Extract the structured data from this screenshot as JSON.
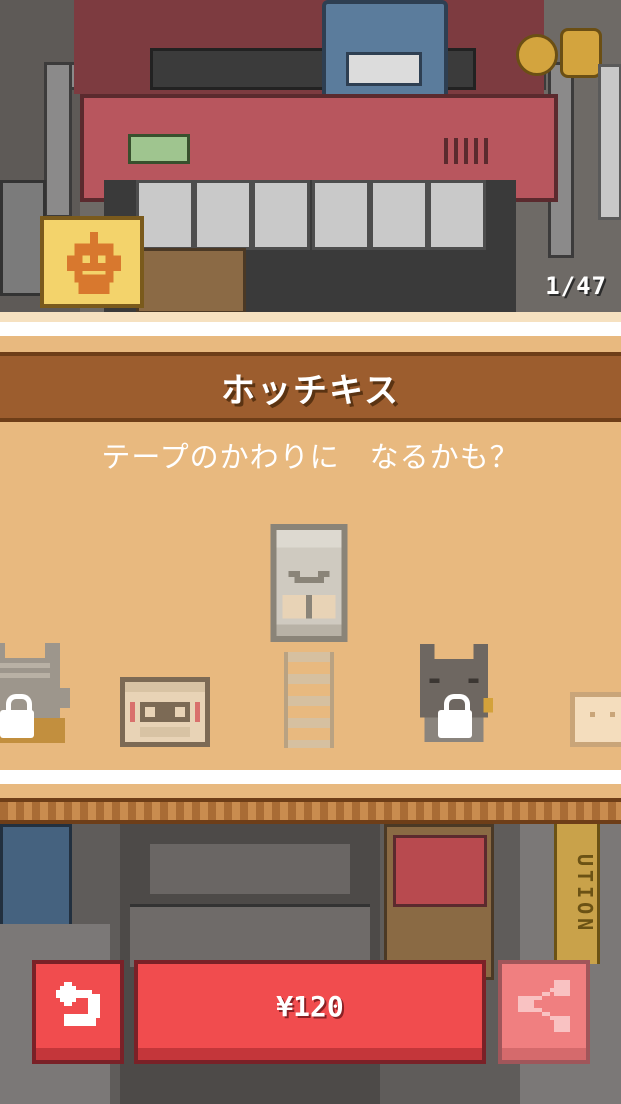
{
  "collection": {
    "counter": "1/47"
  },
  "item": {
    "name": "ホッチキス",
    "description": "テープのかわりに　なるかも？"
  },
  "carousel": {
    "items": [
      {
        "name": "cat-left",
        "locked": true
      },
      {
        "name": "cassette-tape",
        "locked": false
      },
      {
        "name": "stapler",
        "locked": false,
        "selected": true
      },
      {
        "name": "cat-right",
        "locked": true
      },
      {
        "name": "bread",
        "locked": false
      }
    ]
  },
  "actions": {
    "price_label": "¥120"
  },
  "scene": {
    "caution_text": "UTION"
  },
  "colors": {
    "button_red": "#f14c4e",
    "panel": "#e8b97f",
    "title_band": "#9c5d2e",
    "share_disabled": "#f07f80"
  },
  "icons": {
    "back": "back-arrow-icon",
    "share": "share-icon",
    "item_category": "robot-head-icon",
    "lock": "lock-icon"
  }
}
